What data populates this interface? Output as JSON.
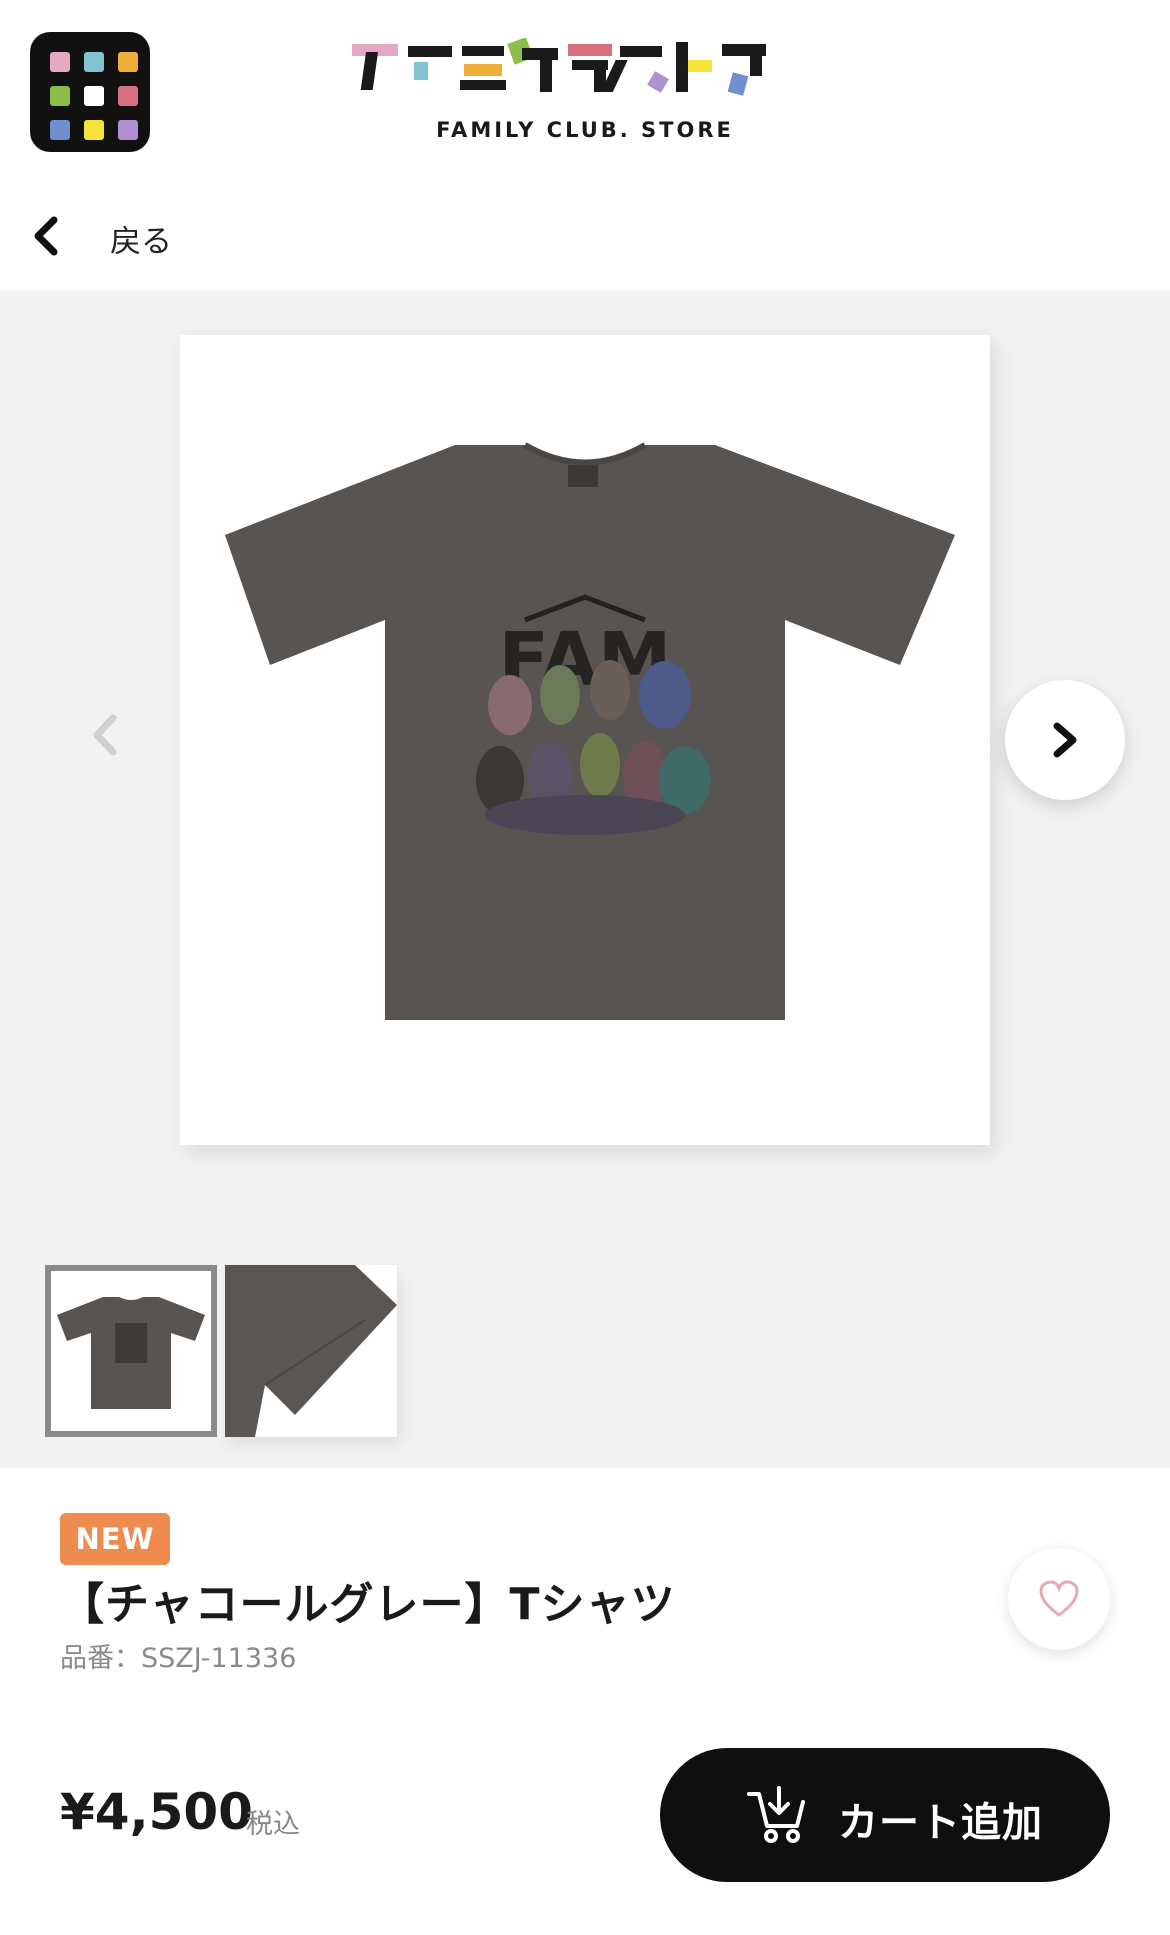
{
  "header": {
    "logo_title": "ファミクラストア",
    "logo_subtitle": "FAMILY CLUB. STORE",
    "app_grid_colors": [
      "#e3a9c2",
      "#80c4d3",
      "#f0ad3a",
      "#8cbf4a",
      "#ffffff",
      "#d9707f",
      "#6f8fd0",
      "#f5e53a",
      "#b08fd3"
    ]
  },
  "nav": {
    "back_label": "戻る"
  },
  "gallery": {
    "main_image_icon": "tshirt-image",
    "shirt_print_text": "FAM",
    "shirt_color": "#585451",
    "thumbnails": [
      {
        "name": "thumbnail-front",
        "active": true
      },
      {
        "name": "thumbnail-sleeve-detail",
        "active": false
      }
    ]
  },
  "product": {
    "badge": "NEW",
    "title": "【チャコールグレー】Tシャツ",
    "code": "品番：SSZJ-11336",
    "price": "¥4,500",
    "tax_note": "税込",
    "cart_label": "カート追加"
  },
  "colors": {
    "badge_bg": "#ee8b4f",
    "cart_bg": "#0f0f0f",
    "heart": "#e8a9b4",
    "gallery_bg": "#f2f2f2"
  }
}
